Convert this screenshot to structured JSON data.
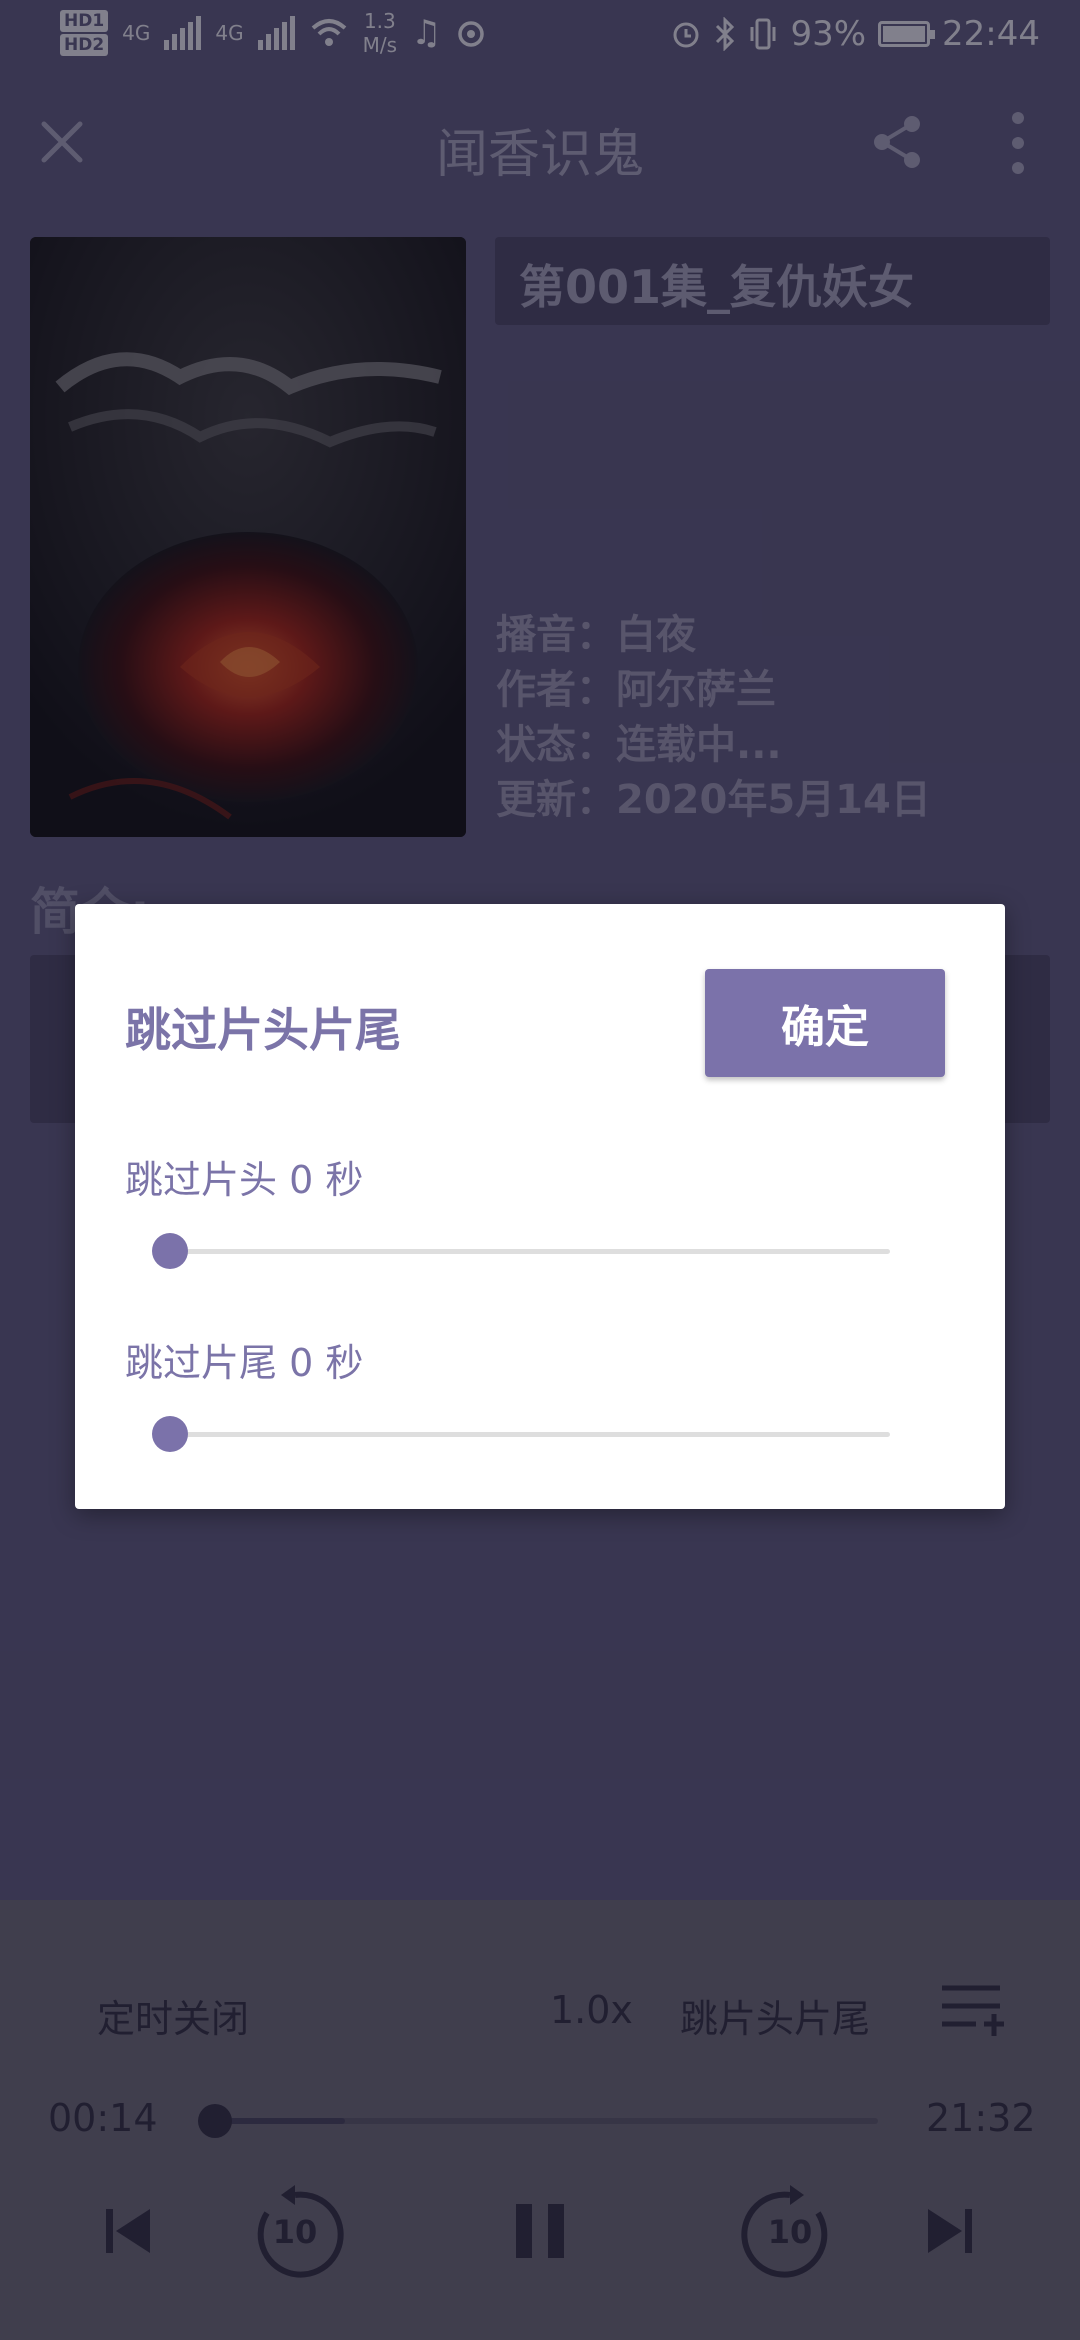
{
  "status_bar": {
    "hd1": "HD1",
    "hd2": "HD2",
    "net1": "4G",
    "net2": "4G",
    "speed_value": "1.3",
    "speed_unit": "M/s",
    "battery": "93%",
    "time": "22:44"
  },
  "header": {
    "title": "闻香识鬼"
  },
  "album": {
    "episode_title": "第001集_复仇妖女",
    "narrator_label": "播音：",
    "narrator": "白夜",
    "author_label": "作者：",
    "author": "阿尔萨兰",
    "status_label": "状态：",
    "status": "连载中...",
    "updated_label": "更新：",
    "updated": "2020年5月14日",
    "intro_label": "简介:"
  },
  "dialog": {
    "title": "跳过片头片尾",
    "confirm_label": "确定",
    "intro_skip_label": "跳过片头 0 秒",
    "intro_skip_seconds": 0,
    "outro_skip_label": "跳过片尾 0 秒",
    "outro_skip_seconds": 0
  },
  "player": {
    "timer_label": "定时关闭",
    "speed_label": "1.0x",
    "skip_label": "跳片头片尾",
    "elapsed": "00:14",
    "duration": "21:32",
    "rewind_seconds": "10",
    "forward_seconds": "10"
  },
  "colors": {
    "accent": "#7b72aa",
    "dialog_text": "#7b74a8",
    "page_background": "#5e5a7e",
    "player_background": "#6c6a77"
  }
}
